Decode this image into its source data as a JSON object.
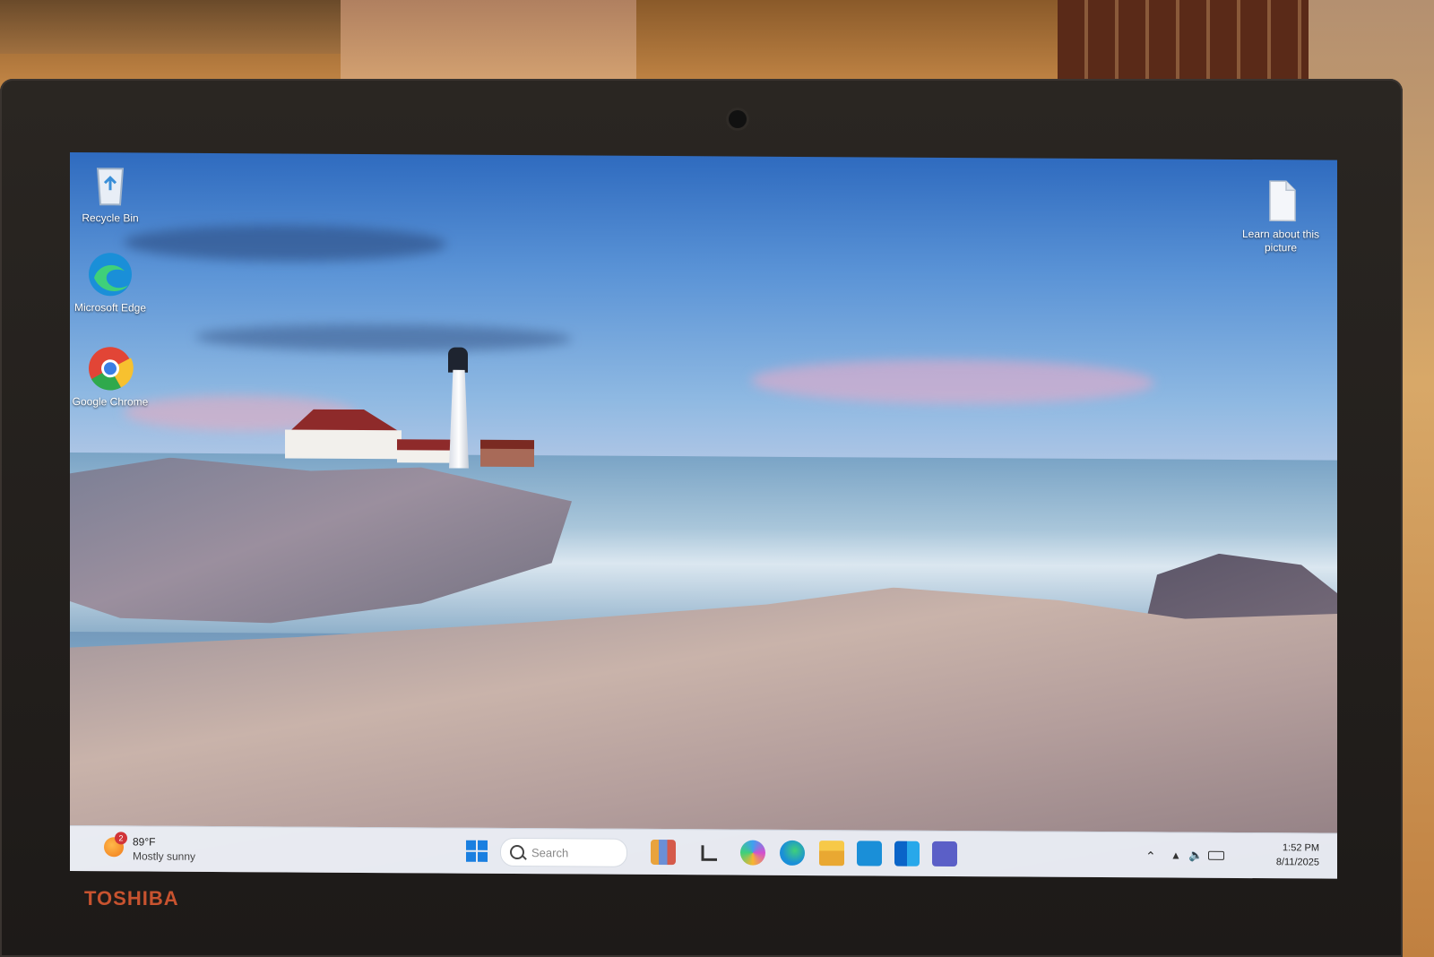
{
  "desktop": {
    "icons_left": [
      {
        "label": "Recycle Bin",
        "icon": "recycle-bin-icon"
      },
      {
        "label": "Microsoft Edge",
        "icon": "edge-icon"
      },
      {
        "label": "Google Chrome",
        "icon": "chrome-icon"
      }
    ],
    "icon_right": {
      "label": "Learn about this picture",
      "icon": "document-icon"
    }
  },
  "taskbar": {
    "weather": {
      "badge": "2",
      "temp": "89°F",
      "condition": "Mostly sunny"
    },
    "search_placeholder": "Search",
    "apps": [
      "widgets-icon",
      "task-view-icon",
      "copilot-icon",
      "edge-icon",
      "file-explorer-icon",
      "store-icon",
      "outlook-icon",
      "teams-icon"
    ],
    "clock": {
      "time": "1:52 PM",
      "date": "8/11/2025"
    }
  },
  "laptop": {
    "brand": "TOSHIBA"
  },
  "colors": {
    "taskbar_bg": "#ecf0f7",
    "brand_text": "#c8532f",
    "accent_blue": "#0078d4"
  }
}
